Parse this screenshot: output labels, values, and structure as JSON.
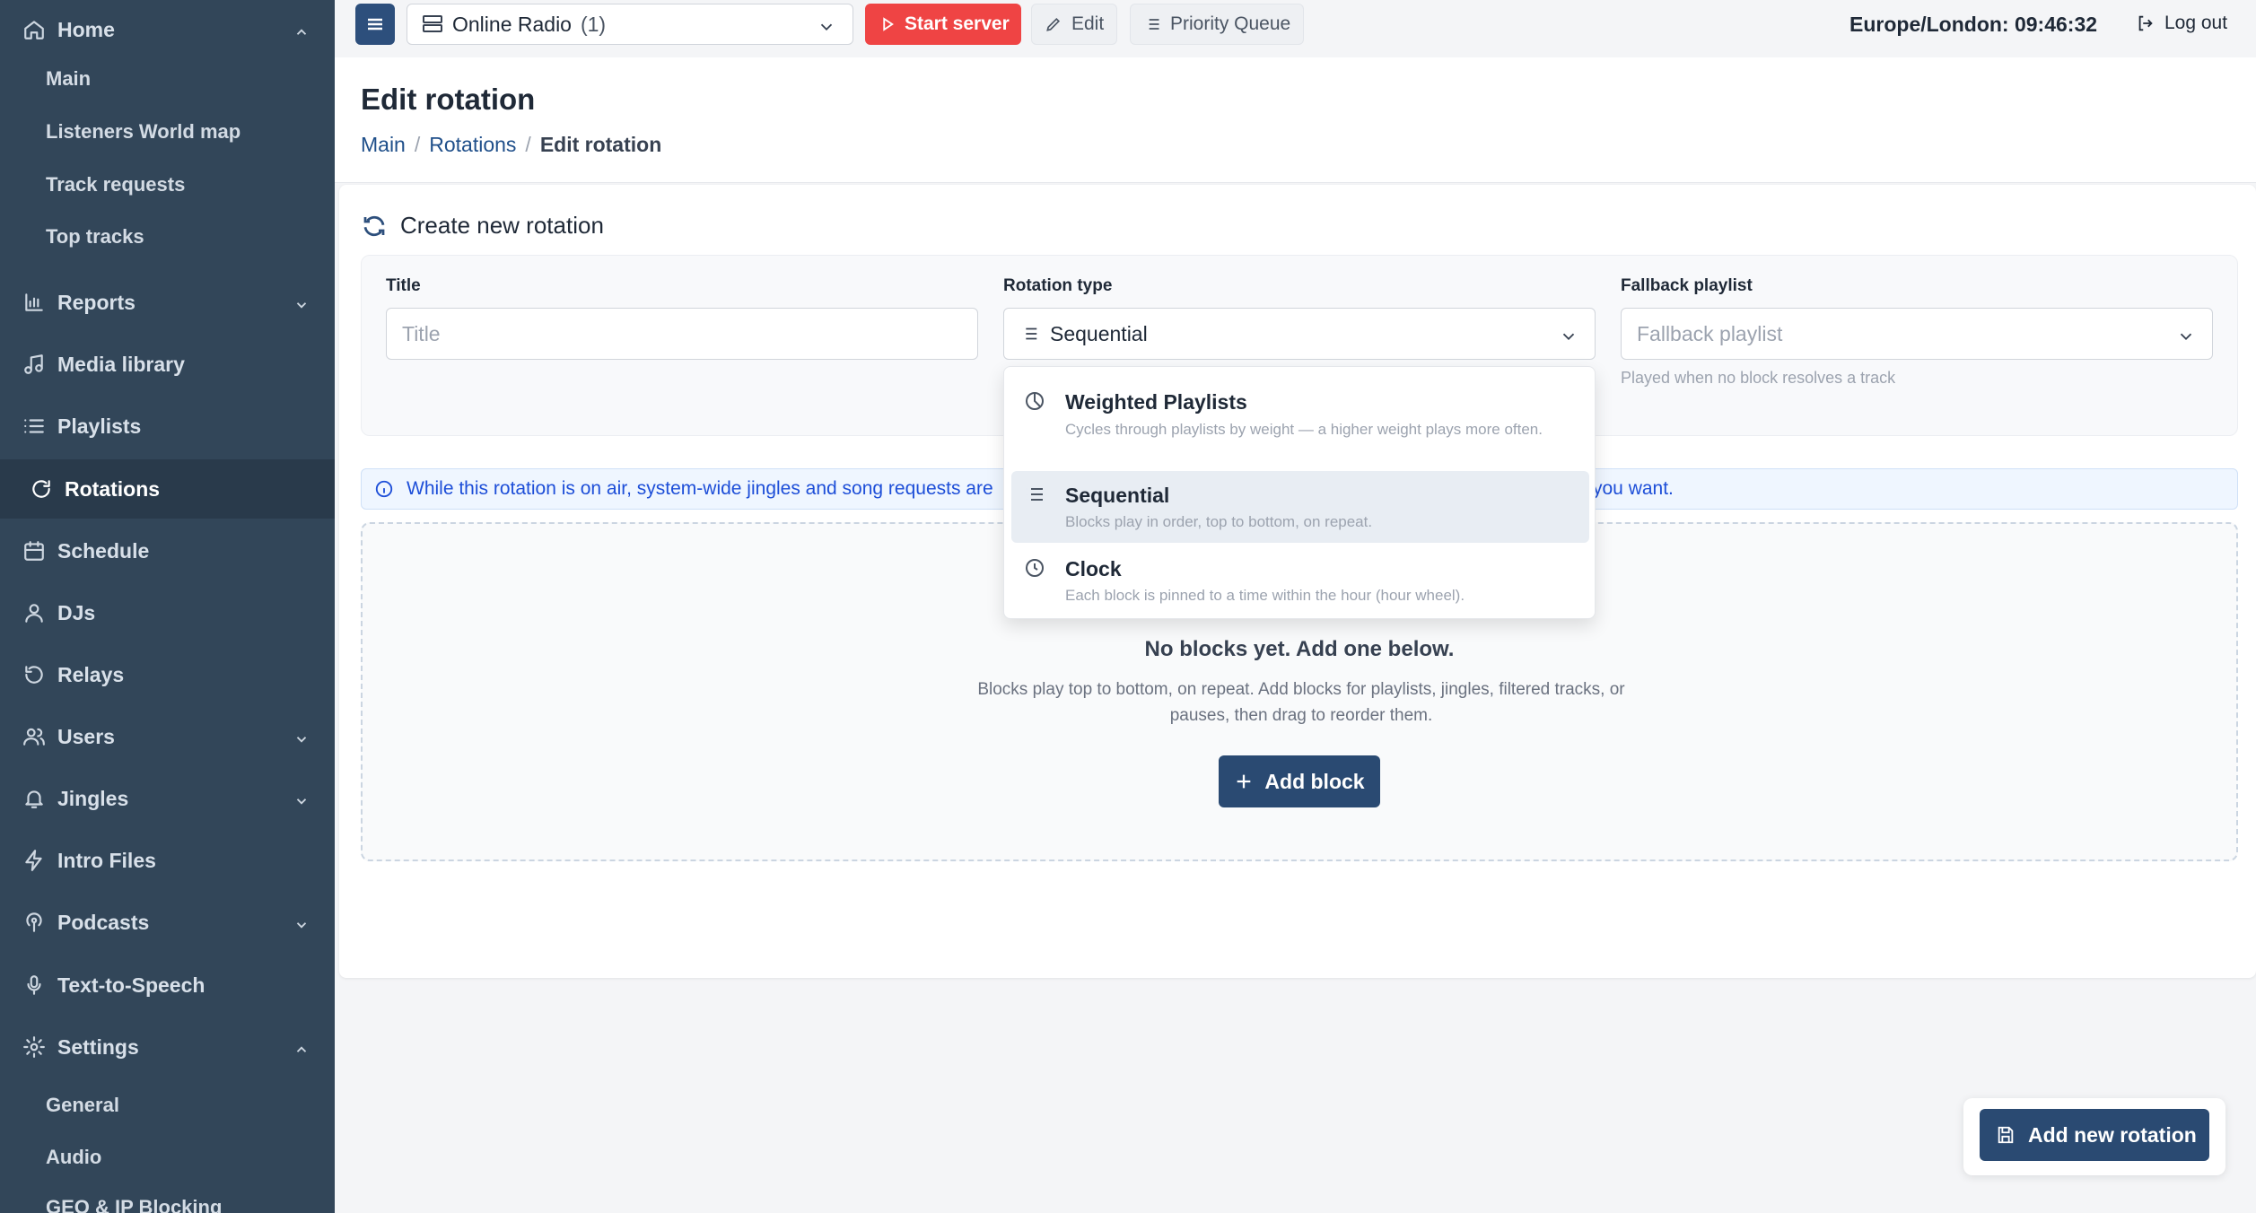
{
  "sidebar": {
    "items": [
      {
        "label": "Home",
        "icon": "home-icon"
      },
      {
        "label": "Main"
      },
      {
        "label": "Listeners World map"
      },
      {
        "label": "Track requests"
      },
      {
        "label": "Top tracks"
      },
      {
        "label": "Reports",
        "icon": "bar-chart-icon"
      },
      {
        "label": "Media library",
        "icon": "music-note-icon"
      },
      {
        "label": "Playlists",
        "icon": "list-icon"
      },
      {
        "label": "Rotations",
        "icon": "rotate-icon"
      },
      {
        "label": "Schedule",
        "icon": "calendar-icon"
      },
      {
        "label": "DJs",
        "icon": "user-icon"
      },
      {
        "label": "Relays",
        "icon": "relay-icon"
      },
      {
        "label": "Users",
        "icon": "users-icon"
      },
      {
        "label": "Jingles",
        "icon": "bell-icon"
      },
      {
        "label": "Intro Files",
        "icon": "lightning-icon"
      },
      {
        "label": "Podcasts",
        "icon": "podcast-icon"
      },
      {
        "label": "Text-to-Speech",
        "icon": "microphone-icon"
      },
      {
        "label": "Settings",
        "icon": "gear-icon"
      },
      {
        "label": "General"
      },
      {
        "label": "Audio"
      },
      {
        "label": "GEO & IP Blocking"
      }
    ]
  },
  "topbar": {
    "station_name": "Online Radio",
    "station_count": "(1)",
    "start_label": "Start server",
    "edit_label": "Edit",
    "queue_label": "Priority Queue",
    "clock": "Europe/London: 09:46:32",
    "logout_label": "Log out"
  },
  "page": {
    "title": "Edit rotation",
    "breadcrumb": [
      "Main",
      "Rotations",
      "Edit rotation"
    ]
  },
  "form": {
    "card_title": "Create new rotation",
    "title_label": "Title",
    "title_placeholder": "Title",
    "type_label": "Rotation type",
    "type_value": "Sequential",
    "fallback_label": "Fallback playlist",
    "fallback_placeholder": "Fallback playlist",
    "fallback_hint": "Played when no block resolves a track"
  },
  "info_banner": {
    "text_left": "While this rotation is on air, system-wide jingles and song requests are",
    "text_right": "you want."
  },
  "empty_state": {
    "title": "No blocks yet. Add one below.",
    "description": "Blocks play top to bottom, on repeat. Add blocks for playlists, jingles, filtered tracks, or pauses, then drag to reorder them.",
    "add_label": "Add block"
  },
  "dropdown": {
    "options": [
      {
        "title": "Weighted Playlists",
        "description": "Cycles through playlists by weight — a higher weight plays more often."
      },
      {
        "title": "Sequential",
        "description": "Blocks play in order, top to bottom, on repeat."
      },
      {
        "title": "Clock",
        "description": "Each block is pinned to a time within the hour (hour wheel)."
      }
    ]
  },
  "save_label": "Add new rotation",
  "colors": {
    "sidebar": "#324659",
    "primary": "#2a4a72",
    "danger": "#ef4444",
    "info": "#1d4ed8"
  }
}
